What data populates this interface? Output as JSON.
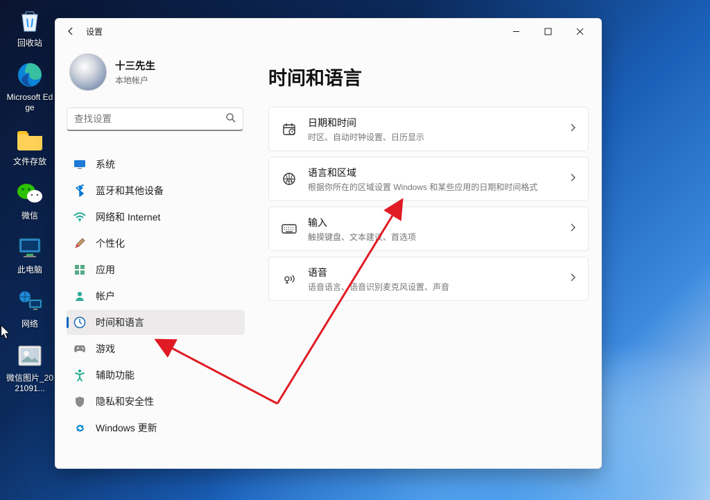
{
  "desktop": {
    "icons": [
      {
        "name": "recycle-bin",
        "label": "回收站"
      },
      {
        "name": "edge",
        "label": "Microsoft Edge"
      },
      {
        "name": "file-storage",
        "label": "文件存放"
      },
      {
        "name": "wechat",
        "label": "微信"
      },
      {
        "name": "this-pc",
        "label": "此电脑"
      },
      {
        "name": "network",
        "label": "网络"
      },
      {
        "name": "wechat-image",
        "label": "微信图片_2021091..."
      }
    ]
  },
  "window": {
    "title": "设置",
    "controls": {
      "minimize": "—",
      "maximize": "□",
      "close": "✕"
    }
  },
  "profile": {
    "name": "十三先生",
    "subtitle": "本地帐户"
  },
  "search": {
    "placeholder": "查找设置"
  },
  "sidebar": {
    "items": [
      {
        "label": "系统",
        "icon": "system",
        "selected": false
      },
      {
        "label": "蓝牙和其他设备",
        "icon": "bluetooth",
        "selected": false
      },
      {
        "label": "网络和 Internet",
        "icon": "wifi",
        "selected": false
      },
      {
        "label": "个性化",
        "icon": "personalize",
        "selected": false
      },
      {
        "label": "应用",
        "icon": "apps",
        "selected": false
      },
      {
        "label": "帐户",
        "icon": "account",
        "selected": false
      },
      {
        "label": "时间和语言",
        "icon": "time-lang",
        "selected": true
      },
      {
        "label": "游戏",
        "icon": "gaming",
        "selected": false
      },
      {
        "label": "辅助功能",
        "icon": "accessibility",
        "selected": false
      },
      {
        "label": "隐私和安全性",
        "icon": "privacy",
        "selected": false
      },
      {
        "label": "Windows 更新",
        "icon": "update",
        "selected": false
      }
    ]
  },
  "main": {
    "title": "时间和语言",
    "cards": [
      {
        "title": "日期和时间",
        "desc": "时区、自动时钟设置、日历显示",
        "icon": "calendar"
      },
      {
        "title": "语言和区域",
        "desc": "根据你所在的区域设置 Windows 和某些应用的日期和时间格式",
        "icon": "globe"
      },
      {
        "title": "输入",
        "desc": "触摸键盘、文本建议、首选项",
        "icon": "keyboard"
      },
      {
        "title": "语音",
        "desc": "语音语言、语音识别麦克风设置、声音",
        "icon": "voice"
      }
    ]
  },
  "annotation": {
    "color": "#e01b24"
  }
}
